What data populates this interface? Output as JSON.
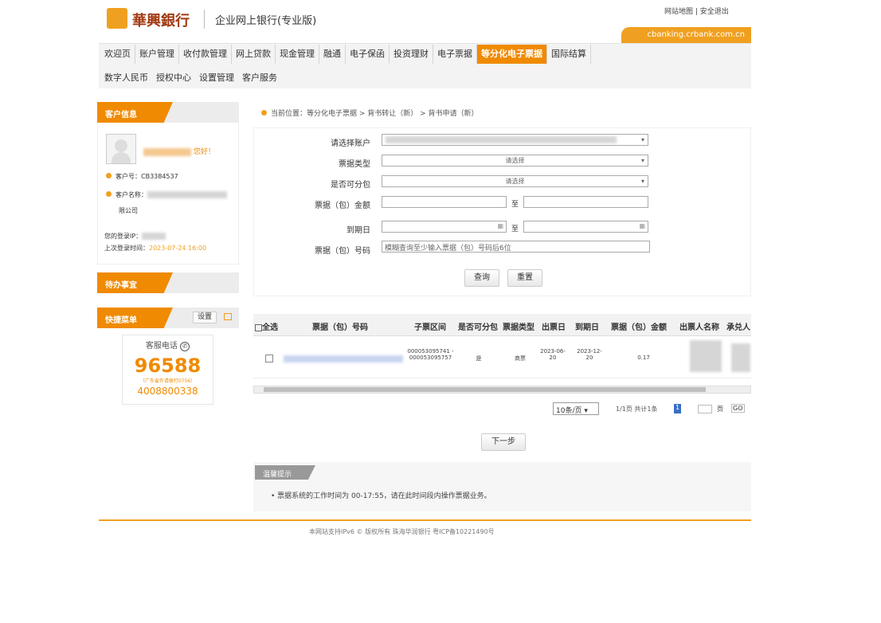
{
  "header": {
    "bank_name": "華興銀行",
    "system_title": "企业网上银行(专业版)",
    "links": "网站地图 | 安全退出",
    "url": "cbanking.crbank.com.cn"
  },
  "nav_row1": [
    {
      "label": "欢迎页",
      "active": false
    },
    {
      "label": "账户管理",
      "active": false
    },
    {
      "label": "收付款管理",
      "active": false
    },
    {
      "label": "网上贷款",
      "active": false
    },
    {
      "label": "现金管理",
      "active": false
    },
    {
      "label": "融通",
      "active": false
    },
    {
      "label": "电子保函",
      "active": false
    },
    {
      "label": "投资理财",
      "active": false
    },
    {
      "label": "电子票据",
      "active": false
    },
    {
      "label": "等分化电子票据",
      "active": true
    },
    {
      "label": "国际结算",
      "active": false
    }
  ],
  "nav_row2": [
    "数字人民币",
    "授权中心",
    "设置管理",
    "客户服务"
  ],
  "sidebar": {
    "account_info_title": "客户信息",
    "greeting": "您好！",
    "customer_no_label": "客户号：",
    "customer_no": "CB3384537",
    "customer_name_label": "客户名称：",
    "customer_name_suffix": "限公司",
    "last_login_ip_label": "您的登录IP：",
    "last_login_time_label": "上次登录时间：",
    "last_login_time": "2023-07-24 16:00",
    "todo_title": "待办事宜",
    "shortcut_title": "快捷菜单",
    "shortcut_setting": "设置",
    "hotline_label": "客服电话",
    "hotline_number": "96588",
    "hotline_note": "（广东省外请拨打0756）",
    "hotline_national": "4008800338"
  },
  "breadcrumb": "当前位置：等分化电子票据 > 背书转让（新） > 背书申请（新）",
  "form": {
    "account_label": "请选择账户",
    "account_value": "",
    "bill_type_label": "票据类型",
    "bill_type_value": "请选择",
    "splittable_label": "是否可分包",
    "splittable_value": "请选择",
    "amount_label": "票据（包）金额",
    "to1": "至",
    "due_label": "到期日",
    "to2": "至",
    "bill_no_label": "票据（包）号码",
    "bill_no_placeholder": "模糊查询至少输入票据（包）号码后6位",
    "query_btn": "查询",
    "reset_btn": "重置"
  },
  "table": {
    "headers": [
      "全选",
      "票据（包）号码",
      "子票区间",
      "是否可分包",
      "票据类型",
      "出票日",
      "到期日",
      "票据（包）金额",
      "出票人名称",
      "承兑人"
    ],
    "rows": [
      {
        "range": "000053095741 - 000053095757",
        "split": "是",
        "type": "商票",
        "issue": "2023-06-20",
        "due": "2023-12-20",
        "amount": "0.17"
      }
    ]
  },
  "pagination": {
    "per_page": "10条/页",
    "info": "1/1页 共计1条",
    "current_page": "1",
    "go_to": "页",
    "go_btn": "GO"
  },
  "next_btn": "下一步",
  "tip": {
    "title": "温馨提示",
    "text": "• 票据系统的工作时间为 00-17:55，请在此时间段内操作票据业务。"
  },
  "footer": "本网站支持IPv6 © 版权所有 珠海华润银行 粤ICP备10221490号"
}
